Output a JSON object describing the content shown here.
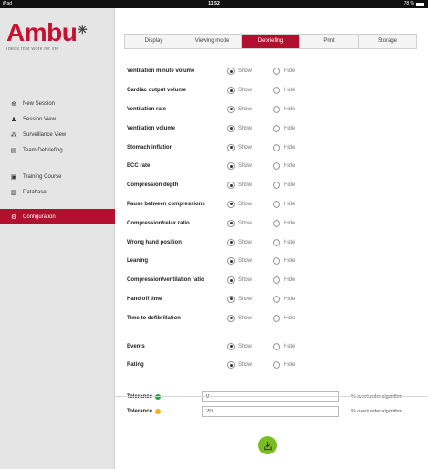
{
  "status_bar": {
    "device": "iPad",
    "time": "11:52",
    "battery": "78 %"
  },
  "logo": {
    "word": "Ambu",
    "tagline": "Ideas that work for life"
  },
  "sidebar": {
    "items": [
      {
        "label": "New Session",
        "icon": "plus-circle-icon"
      },
      {
        "label": "Session View",
        "icon": "person-icon"
      },
      {
        "label": "Surveillance View",
        "icon": "people-icon"
      },
      {
        "label": "Team Debriefing",
        "icon": "clipboard-icon"
      },
      {
        "label": "Training Course",
        "icon": "book-icon"
      },
      {
        "label": "Database",
        "icon": "bar-chart-icon"
      },
      {
        "label": "Configuration",
        "icon": "wrench-icon",
        "active": true
      }
    ]
  },
  "tabs": [
    {
      "label": "Display"
    },
    {
      "label": "Viewing mode"
    },
    {
      "label": "Debriefing",
      "active": true
    },
    {
      "label": "Print"
    },
    {
      "label": "Storage"
    }
  ],
  "option_labels": {
    "show": "Show",
    "hide": "Hide"
  },
  "settings": [
    {
      "label": "Ventilation minute volume",
      "value": "Show"
    },
    {
      "label": "Cardiac output volume",
      "value": "Show"
    },
    {
      "label": "Ventilation rate",
      "value": "Show"
    },
    {
      "label": "Ventilation volume",
      "value": "Show"
    },
    {
      "label": "Stomach inflation",
      "value": "Show"
    },
    {
      "label": "ECC rate",
      "value": "Show"
    },
    {
      "label": "Compression depth",
      "value": "Show"
    },
    {
      "label": "Pause between compressions",
      "value": "Show"
    },
    {
      "label": "Compression/relax ratio",
      "value": "Show"
    },
    {
      "label": "Wrong hand position",
      "value": "Show"
    },
    {
      "label": "Leaning",
      "value": "Show"
    },
    {
      "label": "Compression/ventilation ratio",
      "value": "Show"
    },
    {
      "label": "Hand off time",
      "value": "Show"
    },
    {
      "label": "Time to defibrillation",
      "value": "Show"
    }
  ],
  "settings_extra": [
    {
      "label": "Events",
      "value": "Show"
    },
    {
      "label": "Rating",
      "value": "Show"
    }
  ],
  "tolerance": [
    {
      "label": "Tolerance",
      "color": "#2e9e3e",
      "value": "0",
      "unit": "% over/under algorithm"
    },
    {
      "label": "Tolerance",
      "color": "#f5b324",
      "value": "20",
      "unit": "% over/under algorithm"
    }
  ],
  "colors": {
    "accent": "#b2102e",
    "save": "#78be20"
  },
  "save_button": {
    "icon": "save-download-icon"
  }
}
